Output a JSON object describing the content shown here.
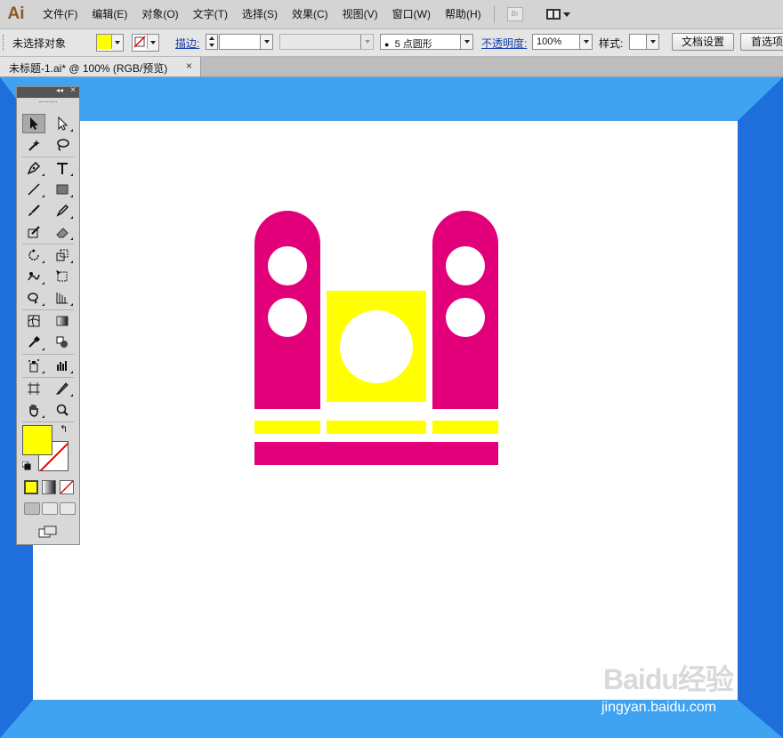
{
  "app": {
    "logo": "Ai"
  },
  "menu": [
    "文件(F)",
    "编辑(E)",
    "对象(O)",
    "文字(T)",
    "选择(S)",
    "效果(C)",
    "视图(V)",
    "窗口(W)",
    "帮助(H)"
  ],
  "menu_extra": {
    "bridge_label": "Br"
  },
  "control_bar": {
    "selection_status": "未选择对象",
    "fill_color": "#ffff00",
    "stroke_label": "描边:",
    "brush_value": "5 点圆形",
    "opacity_label": "不透明度:",
    "opacity_value": "100%",
    "style_label": "样式:",
    "doc_setup_button": "文档设置",
    "preferences_button": "首选项"
  },
  "document_tab": {
    "title": "未标题-1.ai* @ 100% (RGB/预览)",
    "close": "×"
  },
  "colors": {
    "magenta": "#e2007a",
    "yellow": "#ffff00",
    "frame_blue_dark": "#1e6fdb",
    "frame_blue_light": "#3fa3f2",
    "white": "#ffffff"
  },
  "artwork": {
    "description_shapes": [
      "left-speaker",
      "right-speaker",
      "center-yellow-box-with-circle",
      "three-yellow-bars",
      "magenta-base"
    ]
  },
  "tools_panel": {
    "tools": [
      "selection",
      "direct-selection",
      "magic-wand",
      "lasso",
      "pen",
      "type",
      "line",
      "rectangle",
      "paintbrush",
      "pencil",
      "blob-brush",
      "eraser",
      "rotate",
      "scale",
      "warp",
      "free-transform",
      "shape-builder",
      "perspective-grid",
      "mesh",
      "gradient",
      "eyedropper",
      "blend",
      "symbol-sprayer",
      "column-graph",
      "artboard",
      "slice",
      "hand",
      "zoom"
    ],
    "fill_color": "#ffff00"
  },
  "watermark": {
    "text": "Baidu经验",
    "url": "jingyan.baidu.com"
  }
}
